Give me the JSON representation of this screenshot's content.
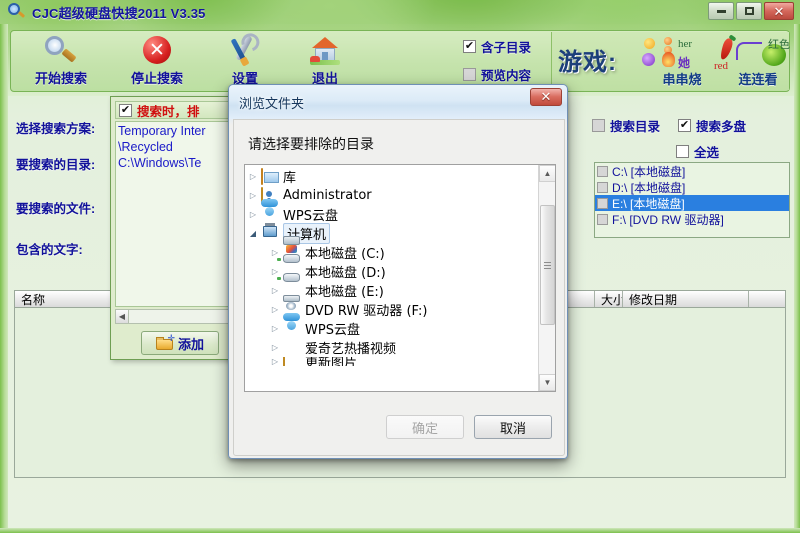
{
  "window": {
    "title": "CJC超级硬盘快搜2011 V3.35",
    "icon": "magnifier-icon",
    "minimize_label": "—",
    "maximize_label": "□",
    "close_label": "✕"
  },
  "toolbar": {
    "buttons": [
      {
        "label": "开始搜索",
        "icon": "magnifier-icon"
      },
      {
        "label": "停止搜索",
        "icon": "stop-circle-icon"
      },
      {
        "label": "设置",
        "icon": "tools-icon"
      },
      {
        "label": "退出",
        "icon": "house-icon"
      }
    ],
    "checkboxes": [
      {
        "label": "含子目录",
        "checked": true
      },
      {
        "label": "预览内容",
        "checked": false
      }
    ]
  },
  "games": {
    "title": "游戏:",
    "items": [
      {
        "label": "串串烧",
        "tag": "her 她"
      },
      {
        "label": "连连看",
        "tag": "red 红色"
      }
    ]
  },
  "form": {
    "labels": [
      "选择搜索方案:",
      "要搜索的目录:",
      "要搜索的文件:",
      "包含的文字:"
    ],
    "values": [
      "",
      "",
      "",
      ""
    ]
  },
  "drives": {
    "checkboxes": [
      {
        "label": "搜索目录",
        "checked": false,
        "disabled": true
      },
      {
        "label": "搜索多盘",
        "checked": true
      },
      {
        "label": "全选",
        "checked": false
      }
    ],
    "rows": [
      {
        "label": "C:\\ [本地磁盘]",
        "checked": false,
        "selected": false
      },
      {
        "label": "D:\\ [本地磁盘]",
        "checked": false,
        "selected": false
      },
      {
        "label": "E:\\ [本地磁盘]",
        "checked": false,
        "selected": true
      },
      {
        "label": "F:\\ [DVD RW 驱动器]",
        "checked": false,
        "selected": false
      }
    ]
  },
  "results": {
    "columns": [
      "名称",
      "大小",
      "修改日期",
      ""
    ],
    "rows": []
  },
  "exclude_panel": {
    "title": "搜索时，排",
    "checked": true,
    "items": [
      "Temporary Inter",
      "\\Recycled",
      "C:\\Windows\\Te"
    ],
    "scroll_arrow": "◀",
    "add_button": "添加",
    "add_icon": "folder-add-icon"
  },
  "browse_dialog": {
    "title": "浏览文件夹",
    "close_label": "✕",
    "prompt": "请选择要排除的目录",
    "tree": [
      {
        "label": "库",
        "icon": "library-icon",
        "level": 0,
        "expander": "collapsed",
        "selected": false
      },
      {
        "label": "Administrator",
        "icon": "user-folder-icon",
        "level": 0,
        "expander": "collapsed",
        "selected": false
      },
      {
        "label": "WPS云盘",
        "icon": "cloud-icon",
        "level": 0,
        "expander": "collapsed",
        "selected": false
      },
      {
        "label": "计算机",
        "icon": "computer-icon",
        "level": 0,
        "expander": "expanded",
        "selected": true
      },
      {
        "label": "本地磁盘 (C:)",
        "icon": "system-drive-icon",
        "level": 1,
        "expander": "collapsed",
        "selected": false
      },
      {
        "label": "本地磁盘 (D:)",
        "icon": "drive-icon",
        "level": 1,
        "expander": "collapsed",
        "selected": false
      },
      {
        "label": "本地磁盘 (E:)",
        "icon": "drive-icon",
        "level": 1,
        "expander": "collapsed",
        "selected": false
      },
      {
        "label": "DVD RW 驱动器 (F:)",
        "icon": "dvd-drive-icon",
        "level": 1,
        "expander": "collapsed",
        "selected": false
      },
      {
        "label": "WPS云盘",
        "icon": "cloud-icon",
        "level": 1,
        "expander": "collapsed",
        "selected": false
      },
      {
        "label": "爱奇艺热播视频",
        "icon": "iqiyi-icon",
        "level": 1,
        "expander": "collapsed",
        "selected": false
      },
      {
        "label": "更新图片",
        "icon": "folder-icon",
        "level": 1,
        "expander": "collapsed",
        "selected": false
      }
    ],
    "scrollbar": {
      "up": "▲",
      "down": "▼"
    },
    "ok_button": "确定",
    "ok_disabled": true,
    "cancel_button": "取消"
  },
  "colors": {
    "window_green": "#9ed17a",
    "panel_green": "#d6ecc1",
    "label_blue": "#12129b",
    "exclude_red": "#d01010",
    "selection_blue": "#2a7fe0",
    "close_red": "#c04b3c"
  }
}
